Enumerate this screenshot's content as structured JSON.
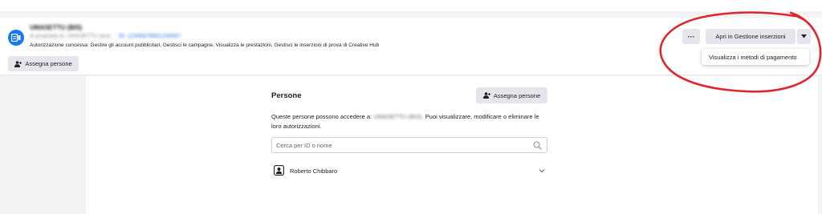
{
  "account": {
    "name": "UMASETTU (BIS)",
    "meta_prefix": "di proprietà di: UMASETTU (bul)",
    "meta_link": "ID: 12345678901234567",
    "permissions": "Autorizzazione concessa: Gestire gli account pubblicitari, Gestisci le campagne, Visualizza le prestazioni, Gestisci le inserzioni di prova di Creative Hub",
    "assign_button": "Assegna persone"
  },
  "toolbar": {
    "more_label": "···",
    "open_manager_label": "Apri in Gestione inserzioni",
    "dropdown_item": "Visualizza i metodi di pagamento"
  },
  "people": {
    "title": "Persone",
    "assign_button": "Assegna persone",
    "description_prefix": "Queste persone possono accedere a:",
    "description_account": "UMASETTU (BIS).",
    "description_suffix": "Puoi visualizzare, modificare o eliminare le loro autorizzazioni.",
    "search_placeholder": "Cerca per ID o nome",
    "members": [
      {
        "name": "Roberto Chibbaro"
      }
    ]
  },
  "colors": {
    "accent": "#1877f2",
    "annotation": "#e0262d",
    "button_bg": "#e4e6eb"
  },
  "icons": {
    "account": "ad-account-icon",
    "assign": "person-add-icon",
    "search": "search-icon",
    "avatar": "user-badge-icon",
    "chevron": "chevron-down-icon",
    "dropdown": "caret-down-icon"
  }
}
